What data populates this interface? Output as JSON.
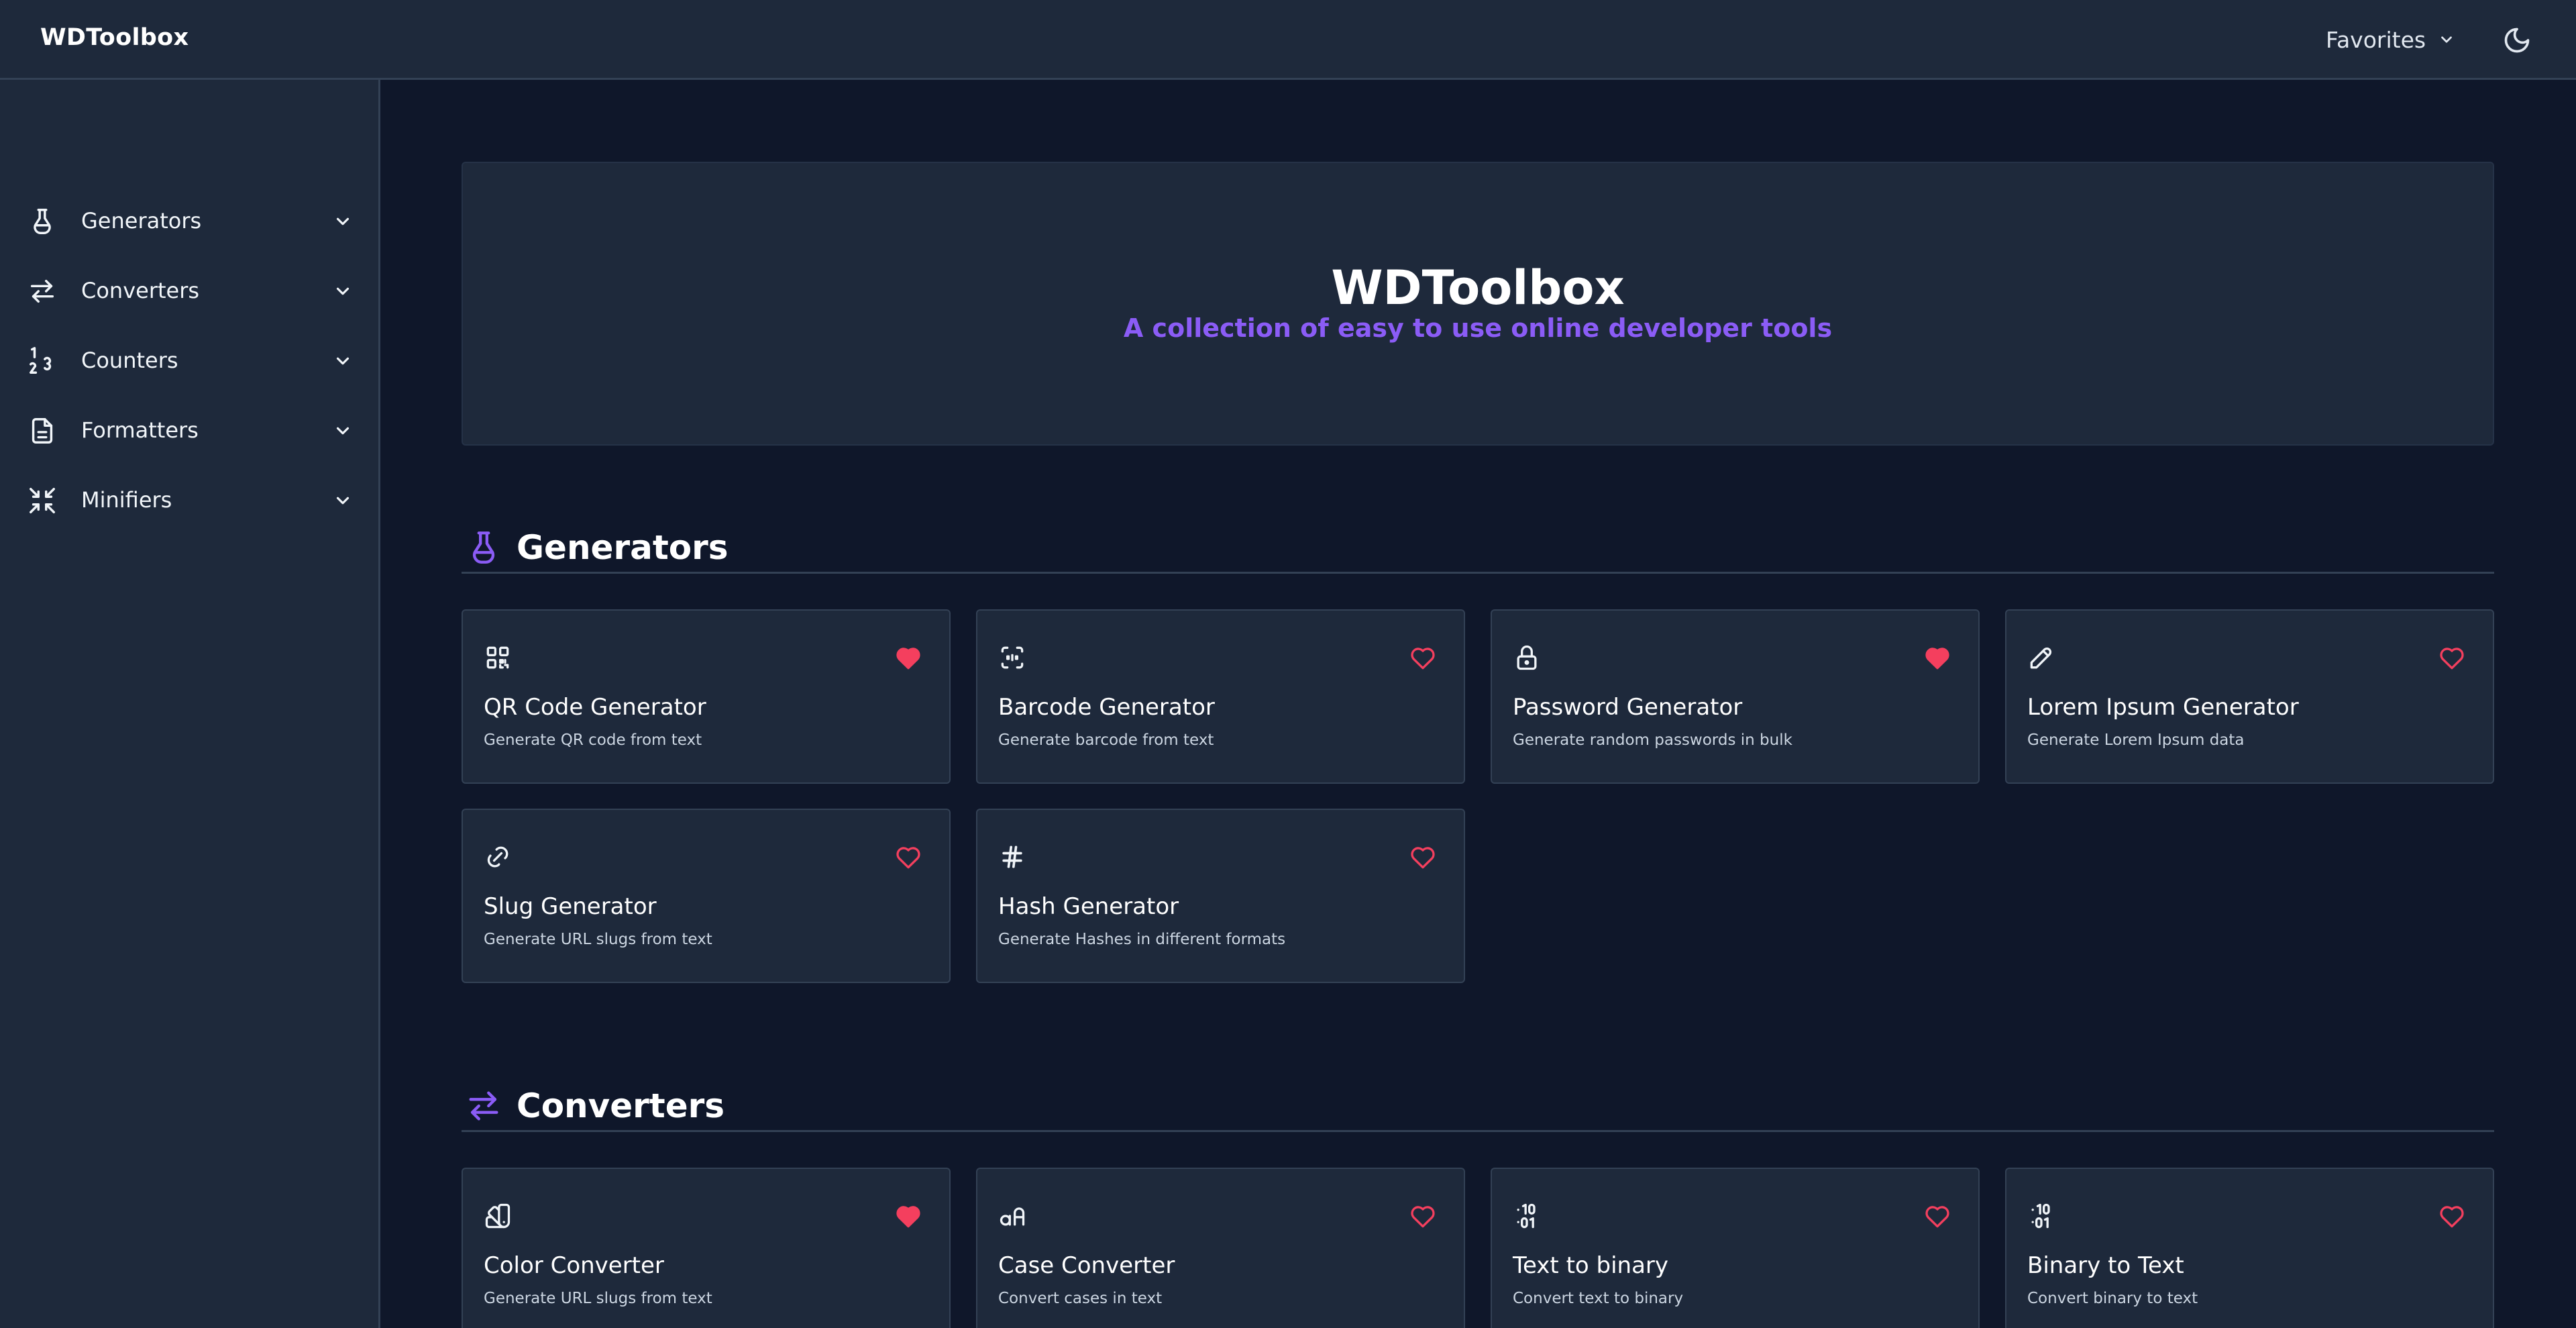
{
  "header": {
    "brand": "WDToolbox",
    "favorites_label": "Favorites"
  },
  "sidebar": {
    "items": [
      {
        "label": "Generators",
        "icon": "flask-icon"
      },
      {
        "label": "Converters",
        "icon": "arrows-exchange-icon"
      },
      {
        "label": "Counters",
        "icon": "numbers-icon"
      },
      {
        "label": "Formatters",
        "icon": "document-icon"
      },
      {
        "label": "Minifiers",
        "icon": "minimize-icon"
      }
    ]
  },
  "hero": {
    "title": "WDToolbox",
    "subtitle": "A collection of easy to use online developer tools"
  },
  "sections": [
    {
      "title": "Generators",
      "icon": "flask-icon",
      "tools": [
        {
          "title": "QR Code Generator",
          "description": "Generate QR code from text",
          "icon": "qr-code-icon",
          "favorite": true
        },
        {
          "title": "Barcode Generator",
          "description": "Generate barcode from text",
          "icon": "barcode-icon",
          "favorite": false
        },
        {
          "title": "Password Generator",
          "description": "Generate random passwords in bulk",
          "icon": "lock-icon",
          "favorite": true
        },
        {
          "title": "Lorem Ipsum Generator",
          "description": "Generate Lorem Ipsum data",
          "icon": "pencil-icon",
          "favorite": false
        },
        {
          "title": "Slug Generator",
          "description": "Generate URL slugs from text",
          "icon": "link-icon",
          "favorite": false
        },
        {
          "title": "Hash Generator",
          "description": "Generate Hashes in different formats",
          "icon": "hash-icon",
          "favorite": false
        }
      ]
    },
    {
      "title": "Converters",
      "icon": "arrows-exchange-icon",
      "tools": [
        {
          "title": "Color Converter",
          "description": "Generate URL slugs from text",
          "icon": "color-swatch-icon",
          "favorite": true
        },
        {
          "title": "Case Converter",
          "description": "Convert cases in text",
          "icon": "letter-case-icon",
          "favorite": false
        },
        {
          "title": "Text to binary",
          "description": "Convert text to binary",
          "icon": "binary-icon",
          "favorite": false
        },
        {
          "title": "Binary to Text",
          "description": "Convert binary to text",
          "icon": "binary-icon",
          "favorite": false
        }
      ]
    }
  ],
  "colors": {
    "page_bg": "#0f172a",
    "panel_bg": "#1e293b",
    "border": "#334155",
    "accent": "#8b5cf6",
    "favorite": "#f43f5e"
  }
}
